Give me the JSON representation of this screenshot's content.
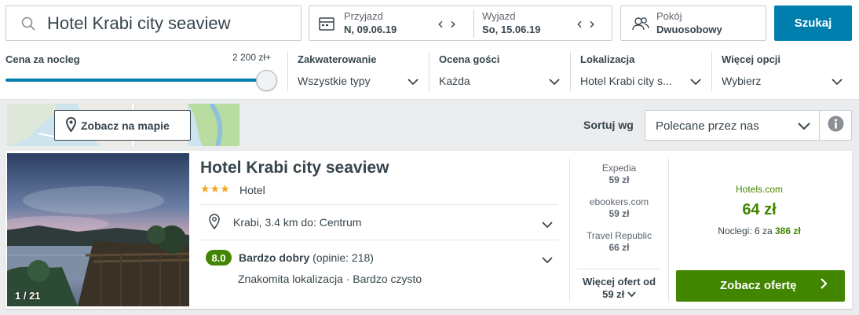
{
  "search": {
    "query": "Hotel Krabi city seaview"
  },
  "dates": {
    "checkin_label": "Przyjazd",
    "checkin_value": "N, 09.06.19",
    "checkout_label": "Wyjazd",
    "checkout_value": "So, 15.06.19"
  },
  "room": {
    "label": "Pokój",
    "value": "Dwuosobowy"
  },
  "search_button": "Szukaj",
  "filters": {
    "price_label": "Cena za nocleg",
    "price_max": "2 200 zł+",
    "price_fraction": 1.0,
    "accommodation_label": "Zakwaterowanie",
    "accommodation_value": "Wszystkie typy",
    "rating_label": "Ocena gości",
    "rating_value": "Każda",
    "location_label": "Lokalizacja",
    "location_value": "Hotel Krabi city s...",
    "more_label": "Więcej opcji",
    "more_value": "Wybierz"
  },
  "map_button": "Zobacz na mapie",
  "sort": {
    "label": "Sortuj wg",
    "value": "Polecane przez nas"
  },
  "hotel": {
    "name": "Hotel Krabi city seaview",
    "stars": "★★★",
    "star_count": 3,
    "type": "Hotel",
    "location": "Krabi, 3.4 km do: Centrum",
    "photo_count": "1 / 21",
    "rating_score": "8.0",
    "rating_word": "Bardzo dobry",
    "rating_count": "(opinie: 218)",
    "rating_highlights": "Znakomita lokalizacja · Bardzo czysto"
  },
  "alt_offers": [
    {
      "site": "Expedia",
      "price": "59 zł"
    },
    {
      "site": "ebookers.com",
      "price": "59 zł"
    },
    {
      "site": "Travel Republic",
      "price": "66 zł"
    }
  ],
  "more_offers": {
    "line1": "Więcej ofert od",
    "line2": "59 zł"
  },
  "deal": {
    "site": "Hotels.com",
    "price": "64 zł",
    "nights_prefix": "Noclegi: 6 za",
    "nights_total": "386 zł",
    "button": "Zobacz ofertę"
  },
  "colors": {
    "brand_blue": "#007faf",
    "deal_green": "#428500",
    "star_orange": "#f5a623"
  }
}
